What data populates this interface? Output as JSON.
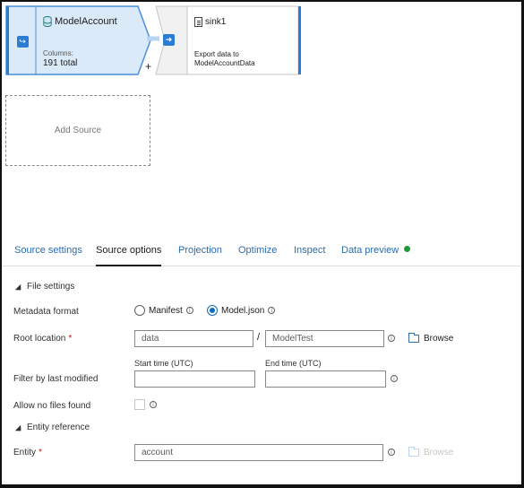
{
  "canvas": {
    "source_node": {
      "title": "ModelAccount",
      "columns_label": "Columns:",
      "columns_value": "191 total"
    },
    "plus_label": "+",
    "sink_node": {
      "title": "sink1",
      "description_line1": "Export data to",
      "description_line2": "ModelAccountData"
    },
    "add_source_label": "Add Source"
  },
  "tabs": [
    {
      "label": "Source settings",
      "active": false
    },
    {
      "label": "Source options",
      "active": true
    },
    {
      "label": "Projection",
      "active": false
    },
    {
      "label": "Optimize",
      "active": false
    },
    {
      "label": "Inspect",
      "active": false
    },
    {
      "label": "Data preview",
      "active": false,
      "status_color": "#1f9a3b"
    }
  ],
  "file_settings": {
    "header": "File settings",
    "metadata_format": {
      "label": "Metadata format",
      "options": [
        {
          "label": "Manifest",
          "selected": false
        },
        {
          "label": "Model.json",
          "selected": true
        }
      ]
    },
    "root_location": {
      "label": "Root location",
      "required": "*",
      "container_value": "data",
      "separator": "/",
      "folder_value": "ModelTest",
      "browse_label": "Browse"
    },
    "filter": {
      "label": "Filter by last modified",
      "start_label": "Start time (UTC)",
      "end_label": "End time (UTC)",
      "start_value": "",
      "end_value": ""
    },
    "allow_no_files": {
      "label": "Allow no files found",
      "checked": false
    }
  },
  "entity_reference": {
    "header": "Entity reference",
    "entity": {
      "label": "Entity",
      "required": "*",
      "value": "account",
      "browse_label": "Browse"
    }
  },
  "info_glyph": "i",
  "icons": {
    "source_type": "source-arrow-icon",
    "sink_type": "sink-arrow-icon",
    "dataset": "database-icon",
    "sink_file": "file-icon",
    "info": "info-icon",
    "folder": "folder-icon",
    "collapse": "collapse-triangle-icon"
  },
  "colors": {
    "accent": "#0f6cbd",
    "link": "#2b6cb0",
    "selected_node_fill": "#dbeaf9",
    "status_green": "#1f9a3b",
    "required": "#c50f1f"
  }
}
